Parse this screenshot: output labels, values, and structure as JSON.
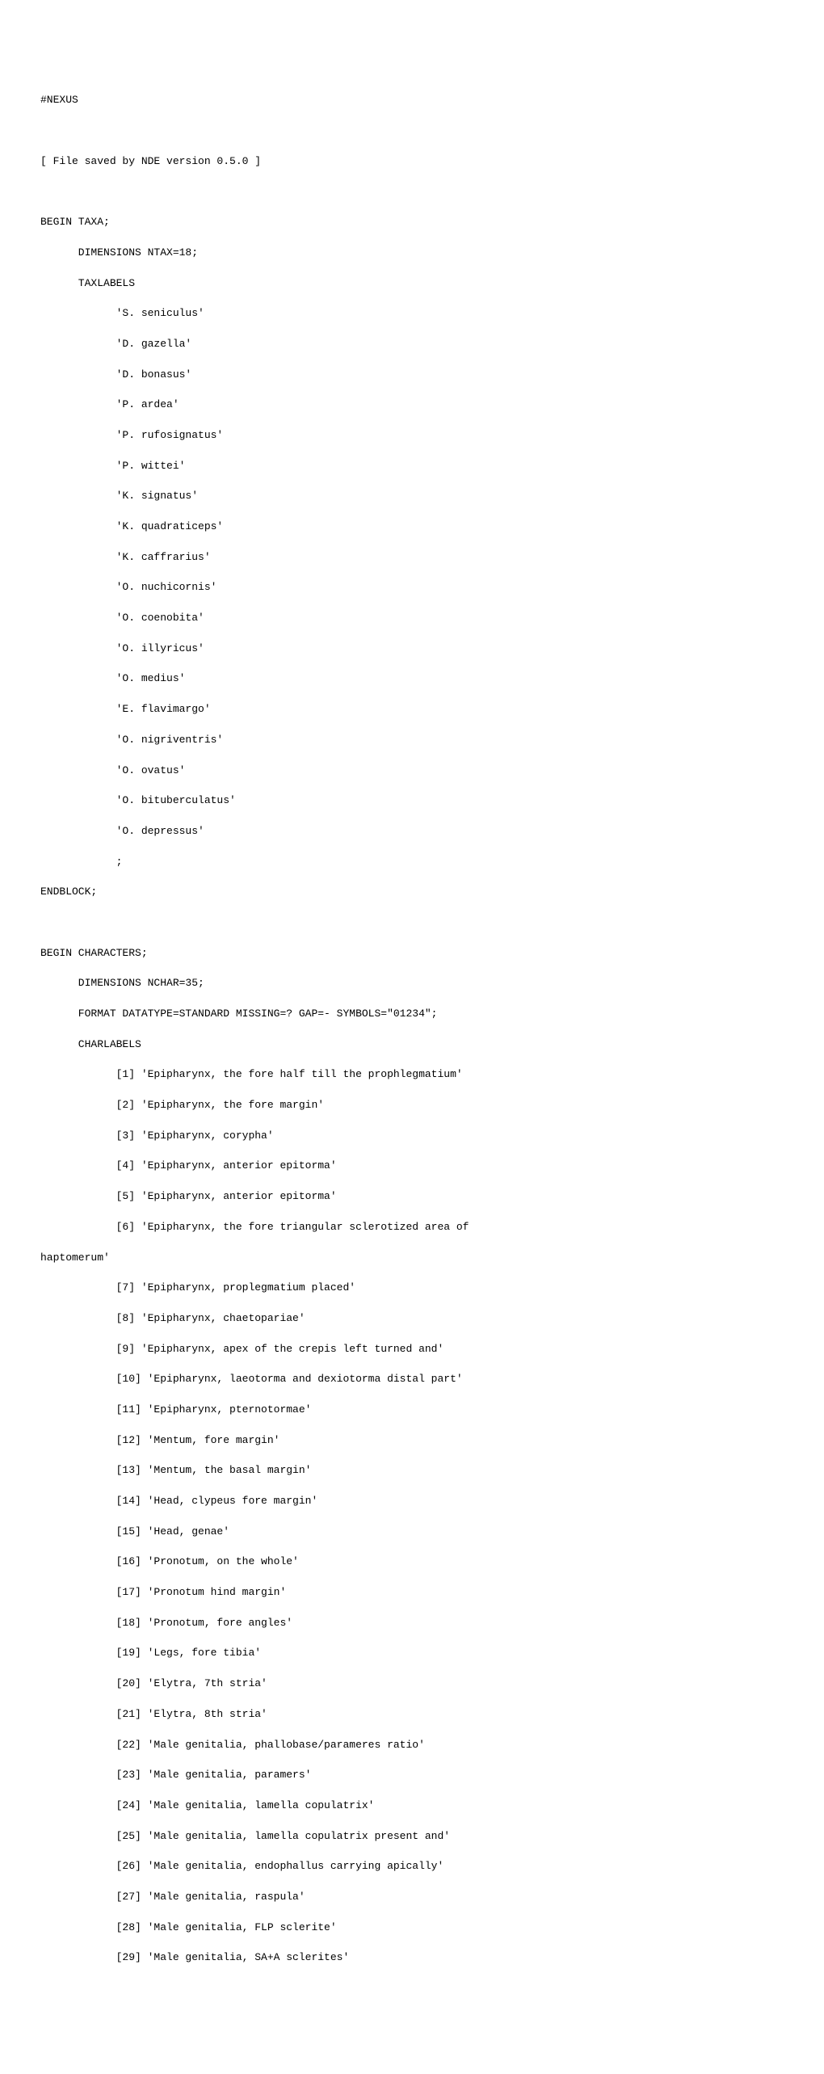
{
  "header": "#NEXUS",
  "file_comment": "[ File saved by NDE version 0.5.0 ]",
  "taxa": {
    "begin": "BEGIN TAXA;",
    "dimensions": "      DIMENSIONS NTAX=18;",
    "taxlabels": "      TAXLABELS",
    "labels": [
      "            'S. seniculus'",
      "            'D. gazella'",
      "            'D. bonasus'",
      "            'P. ardea'",
      "            'P. rufosignatus'",
      "            'P. wittei'",
      "            'K. signatus'",
      "            'K. quadraticeps'",
      "            'K. caffrarius'",
      "            'O. nuchicornis'",
      "            'O. coenobita'",
      "            'O. illyricus'",
      "            'O. medius'",
      "            'E. flavimargo'",
      "            'O. nigriventris'",
      "            'O. ovatus'",
      "            'O. bituberculatus'",
      "            'O. depressus'"
    ],
    "semicolon": "            ;",
    "endblock": "ENDBLOCK;"
  },
  "characters": {
    "begin": "BEGIN CHARACTERS;",
    "dimensions": "      DIMENSIONS NCHAR=35;",
    "format": "      FORMAT DATATYPE=STANDARD MISSING=? GAP=- SYMBOLS=\"01234\";",
    "charlabels": "      CHARLABELS",
    "labels": [
      "            [1] 'Epipharynx, the fore half till the prophlegmatium'",
      "            [2] 'Epipharynx, the fore margin'",
      "            [3] 'Epipharynx, corypha'",
      "            [4] 'Epipharynx, anterior epitorma'",
      "            [5] 'Epipharynx, anterior epitorma'",
      "            [6] 'Epipharynx, the fore triangular sclerotized area of",
      "haptomerum'",
      "            [7] 'Epipharynx, proplegmatium placed'",
      "            [8] 'Epipharynx, chaetopariae'",
      "            [9] 'Epipharynx, apex of the crepis left turned and'",
      "            [10] 'Epipharynx, laeotorma and dexiotorma distal part'",
      "            [11] 'Epipharynx, pternotormae'",
      "            [12] 'Mentum, fore margin'",
      "            [13] 'Mentum, the basal margin'",
      "            [14] 'Head, clypeus fore margin'",
      "            [15] 'Head, genae'",
      "            [16] 'Pronotum, on the whole'",
      "            [17] 'Pronotum hind margin'",
      "            [18] 'Pronotum, fore angles'",
      "            [19] 'Legs, fore tibia'",
      "            [20] 'Elytra, 7th stria'",
      "            [21] 'Elytra, 8th stria'",
      "            [22] 'Male genitalia, phallobase/parameres ratio'",
      "            [23] 'Male genitalia, paramers'",
      "            [24] 'Male genitalia, lamella copulatrix'",
      "            [25] 'Male genitalia, lamella copulatrix present and'",
      "            [26] 'Male genitalia, endophallus carrying apically'",
      "            [27] 'Male genitalia, raspula'",
      "            [28] 'Male genitalia, FLP sclerite'",
      "            [29] 'Male genitalia, SA+A sclerites'"
    ]
  }
}
